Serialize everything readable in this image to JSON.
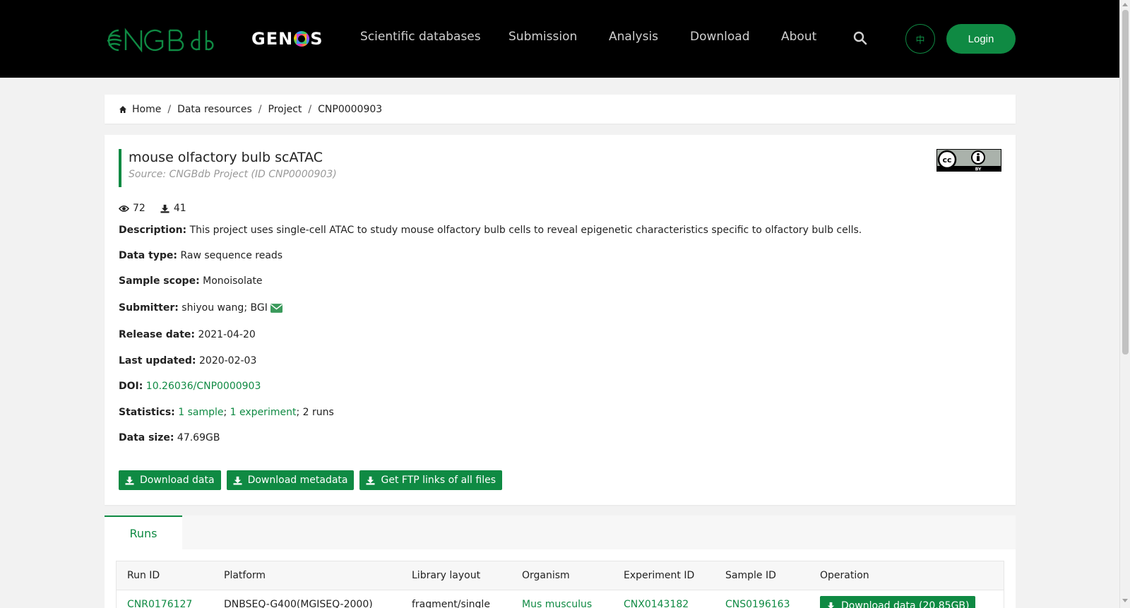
{
  "header": {
    "logo_text": "CNGBdb",
    "genos_logo": {
      "prefix": "GEN",
      "suffix": "S"
    },
    "nav": [
      "Scientific databases",
      "Submission",
      "Analysis",
      "Download",
      "About"
    ],
    "lang_label": "中",
    "login_label": "Login",
    "accent_color": "#0f8a43"
  },
  "breadcrumb": [
    "Home",
    "Data resources",
    "Project",
    "CNP0000903"
  ],
  "project": {
    "title": "mouse olfactory bulb scATAC",
    "source": "Source: CNGBdb Project (ID CNP0000903)",
    "license": "CC BY",
    "views": "72",
    "downloads": "41",
    "fields": [
      {
        "label": "Description:",
        "value": "This project uses single-cell ATAC to study mouse olfactory bulb cells to reveal epigenetic characteristics specific to olfactory bulb cells."
      },
      {
        "label": "Data type:",
        "value": "Raw sequence reads"
      },
      {
        "label": "Sample scope:",
        "value": "Monoisolate"
      },
      {
        "label": "Submitter:",
        "value": "shiyou wang; BGI"
      },
      {
        "label": "Release date:",
        "value": "2021-04-20"
      },
      {
        "label": "Last updated:",
        "value": "2020-02-03"
      },
      {
        "label": "DOI:",
        "value": "10.26036/CNP0000903"
      },
      {
        "label": "Statistics:",
        "value": ""
      },
      {
        "label": "Data size:",
        "value": "47.69GB"
      }
    ],
    "statistics": {
      "samples": "1 sample",
      "experiments": "1 experiment",
      "runs": "; 2 runs",
      "sep": "; "
    },
    "buttons": [
      "Download data",
      "Download metadata",
      "Get FTP links of all files"
    ]
  },
  "tabs": {
    "active": "Runs"
  },
  "runs_table": {
    "headers": [
      "Run ID",
      "Platform",
      "Library layout",
      "Organism",
      "Experiment ID",
      "Sample ID",
      "Operation"
    ],
    "rows": [
      {
        "run_id": "CNR0176127",
        "platform": "DNBSEQ-G400(MGISEQ-2000)",
        "layout": "fragment/single",
        "organism": "Mus musculus",
        "experiment_id": "CNX0143182",
        "sample_id": "CNS0196163",
        "operation": "Download data (20.85GB)"
      }
    ]
  }
}
